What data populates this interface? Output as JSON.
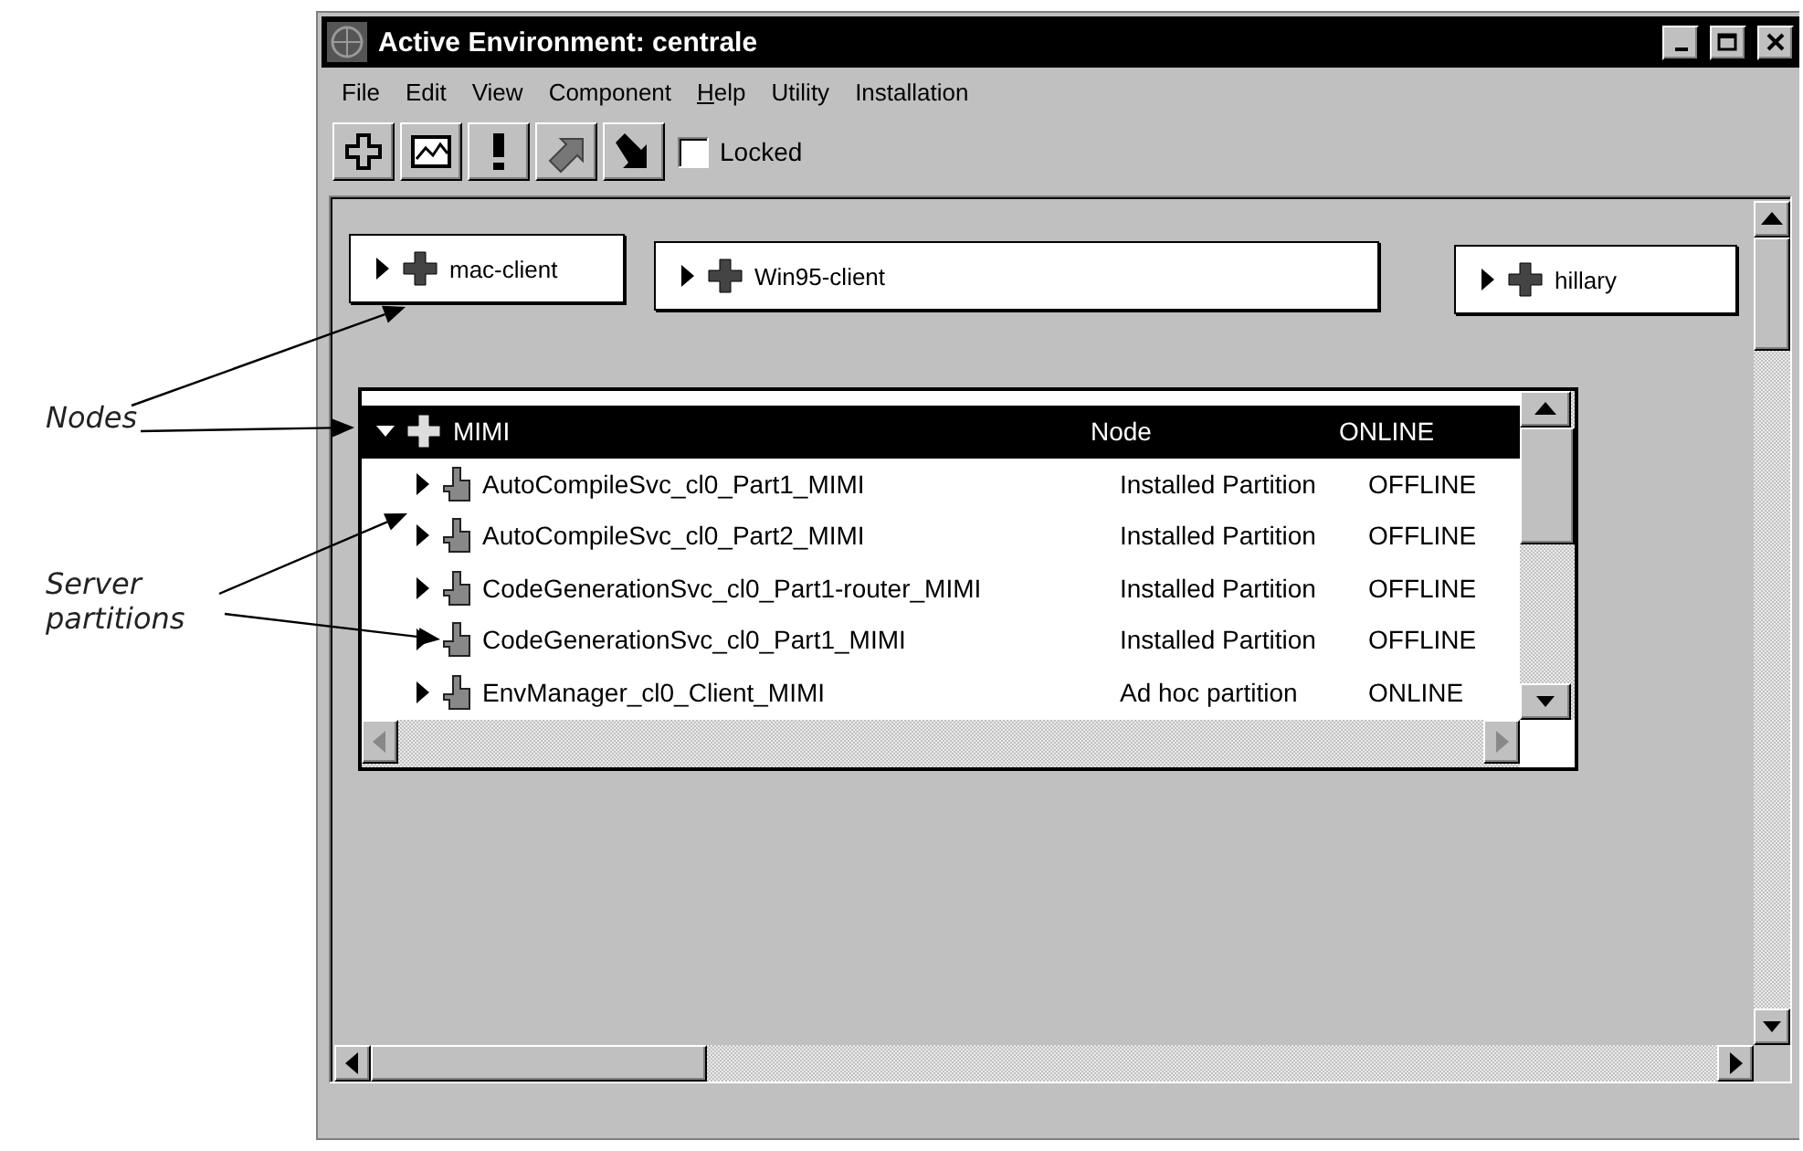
{
  "window": {
    "title": "Active Environment: centrale"
  },
  "menu": [
    {
      "label": "File",
      "mnemonic": false
    },
    {
      "label": "Edit",
      "mnemonic": false
    },
    {
      "label": "View",
      "mnemonic": false
    },
    {
      "label": "Component",
      "mnemonic": false
    },
    {
      "label": "Help",
      "mnemonic": true
    },
    {
      "label": "Utility",
      "mnemonic": false
    },
    {
      "label": "Installation",
      "mnemonic": false
    }
  ],
  "toolbar": {
    "buttons": [
      {
        "kind": "cross"
      },
      {
        "kind": "chart"
      },
      {
        "kind": "alert"
      },
      {
        "kind": "up"
      },
      {
        "kind": "down"
      }
    ],
    "locked": {
      "label": "Locked",
      "checked": false
    }
  },
  "nodes": [
    {
      "name": "mac-client",
      "expanded": false
    },
    {
      "name": "Win95-client",
      "expanded": false
    },
    {
      "name": "hillary",
      "expanded": false
    }
  ],
  "tree": [
    {
      "name": "MIMI",
      "type": "Node",
      "status": "ONLINE",
      "selected": true,
      "expanded": true,
      "children": [
        {
          "name": "AutoCompileSvc_cl0_Part1_MIMI",
          "type": "Installed Partition",
          "status": "OFFLINE",
          "selected": false,
          "expanded": false
        },
        {
          "name": "AutoCompileSvc_cl0_Part2_MIMI",
          "type": "Installed Partition",
          "status": "OFFLINE",
          "selected": false,
          "expanded": false
        },
        {
          "name": "CodeGenerationSvc_cl0_Part1-router_MIMI",
          "type": "Installed Partition",
          "status": "OFFLINE",
          "selected": false,
          "expanded": false
        },
        {
          "name": "CodeGenerationSvc_cl0_Part1_MIMI",
          "type": "Installed Partition",
          "status": "OFFLINE",
          "selected": false,
          "expanded": false
        },
        {
          "name": "EnvManager_cl0_Client_MIMI",
          "type": "Ad hoc partition",
          "status": "ONLINE",
          "selected": false,
          "expanded": false
        }
      ]
    }
  ],
  "annotations": [
    {
      "text": "Nodes"
    },
    {
      "text": "Server partitions"
    }
  ]
}
